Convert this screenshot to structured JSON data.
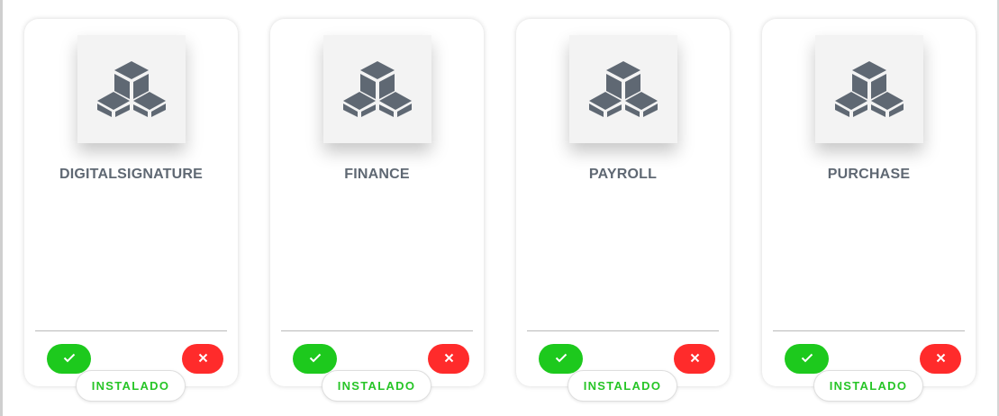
{
  "colors": {
    "accept": "#1dc91d",
    "reject": "#ff2b2b",
    "status_text": "#27c527",
    "title_text": "#5f6873",
    "icon": "#5f6873"
  },
  "modules": [
    {
      "name": "DIGITALSIGNATURE",
      "icon": "cubes-icon",
      "status": "INSTALADO"
    },
    {
      "name": "FINANCE",
      "icon": "cubes-icon",
      "status": "INSTALADO"
    },
    {
      "name": "PAYROLL",
      "icon": "cubes-icon",
      "status": "INSTALADO"
    },
    {
      "name": "PURCHASE",
      "icon": "cubes-icon",
      "status": "INSTALADO"
    }
  ]
}
